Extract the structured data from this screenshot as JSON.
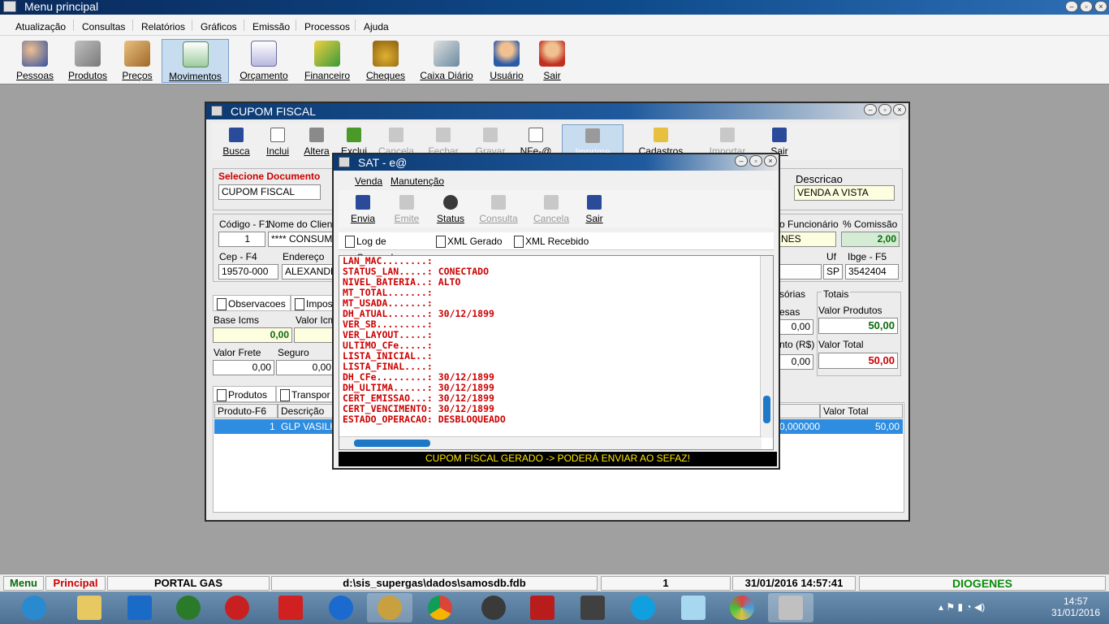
{
  "app": {
    "title": "Menu principal"
  },
  "menu": [
    "Atualização",
    "Consultas",
    "Relatórios",
    "Gráficos",
    "Emissão",
    "Processos",
    "Ajuda"
  ],
  "toolbar": [
    {
      "label": "Pessoas",
      "icon": "people-icon"
    },
    {
      "label": "Produtos",
      "icon": "cart-icon"
    },
    {
      "label": "Preços",
      "icon": "box-icon"
    },
    {
      "label": "Movimentos",
      "icon": "document-icon"
    },
    {
      "label": "Orçamento",
      "icon": "list-icon"
    },
    {
      "label": "Financeiro",
      "icon": "money-icon"
    },
    {
      "label": "Cheques",
      "icon": "moneybag-icon"
    },
    {
      "label": "Caixa Diário",
      "icon": "cash-register-icon"
    },
    {
      "label": "Usuário",
      "icon": "user-icon"
    },
    {
      "label": "Sair",
      "icon": "exit-user-icon"
    }
  ],
  "cupom": {
    "title": "CUPOM FISCAL",
    "toolbar": [
      "Busca",
      "Inclui",
      "Altera",
      "Exclui",
      "Cancela",
      "Fechar",
      "Gravar",
      "NFe-@",
      "Imprime",
      "Cadastros",
      "Importar",
      "Sair"
    ],
    "selecione_label": "Selecione Documento",
    "documento": "CUPOM FISCAL",
    "descricao_label": "Descricao",
    "descricao_value": "VENDA A VISTA",
    "codigo_label": "Código - F1",
    "codigo_value": "1",
    "nome_label": "Nome do Cliente",
    "nome_value": "**** CONSUMID",
    "funcionario_label": "o Funcionário",
    "funcionario_value": "NES",
    "comissao_label": "% Comissão",
    "comissao_value": "2,00",
    "cep_label": "Cep - F4",
    "cep_value": "19570-000",
    "endereco_label": "Endereço",
    "endereco_value": "ALEXANDR",
    "uf_label": "Uf",
    "uf_value": "SP",
    "ibge_label": "Ibge - F5",
    "ibge_value": "3542404",
    "tab_obs": "Observacoes",
    "tab_imp": "Impos",
    "base_icms_label": "Base Icms",
    "base_icms_value": "0,00",
    "valor_icms_label": "Valor Icms",
    "valor_frete_label": "Valor Frete",
    "valor_frete_value": "0,00",
    "seguro_label": "Seguro",
    "seguro_value": "0,00",
    "acessorias_label": "sórias",
    "despesas_label": "esas",
    "despesas_value": "0,00",
    "desconto_label": "nto (R$)",
    "desconto_value": "0,00",
    "totais_label": "Totais",
    "valor_produtos_label": "Valor Produtos",
    "valor_produtos_value": "50,00",
    "valor_total_label": "Valor Total",
    "valor_total_value": "50,00",
    "tab_produtos": "Produtos",
    "tab_transp": "Transpor",
    "grid_cols": [
      "Produto-F6",
      "Descrição",
      "Valor Total"
    ],
    "grid_row": {
      "produto": "1",
      "descricao": "GLP VASILH",
      "qtd": "0,000000",
      "valor_total": "50,00"
    }
  },
  "sat": {
    "title": "SAT - e@",
    "menu": [
      "Venda",
      "Manutenção"
    ],
    "toolbar": [
      "Envia",
      "Emite",
      "Status",
      "Consulta",
      "Cancela",
      "Sair"
    ],
    "tabs": [
      "Log de Comando",
      "XML Gerado",
      "XML Recebido"
    ],
    "log": [
      "LAN_MAC........:",
      "STATUS_LAN.....: CONECTADO",
      "NIVEL_BATERIA..: ALTO",
      "MT_TOTAL.......:",
      "MT_USADA.......:",
      "DH_ATUAL.......: 30/12/1899",
      "VER_SB.........:",
      "VER_LAYOUT.....:",
      "ULTIMO_CFe.....:",
      "LISTA_INICIAL..:",
      "LISTA_FINAL....:",
      "DH_CFe.........: 30/12/1899",
      "DH_ULTIMA......: 30/12/1899",
      "CERT_EMISSAO...: 30/12/1899",
      "CERT_VENCIMENTO: 30/12/1899",
      "ESTADO_OPERACAO: DESBLOQUEADO"
    ],
    "status": "CUPOM FISCAL GERADO -> PODERÁ ENVIAR AO SEFAZ!"
  },
  "statusbar": {
    "menu": "Menu",
    "principal": "Principal",
    "empresa": "PORTAL GAS",
    "db": "d:\\sis_supergas\\dados\\samosdb.fdb",
    "num": "1",
    "datetime": "31/01/2016 14:57:41",
    "user": "DIOGENES"
  },
  "taskbar": {
    "time": "14:57",
    "date": "31/01/2016"
  },
  "colors": {
    "accent": "#2e8de0",
    "alert": "#cc0000",
    "ok": "#0b6b0b",
    "titlebar": "#0c3a72"
  }
}
